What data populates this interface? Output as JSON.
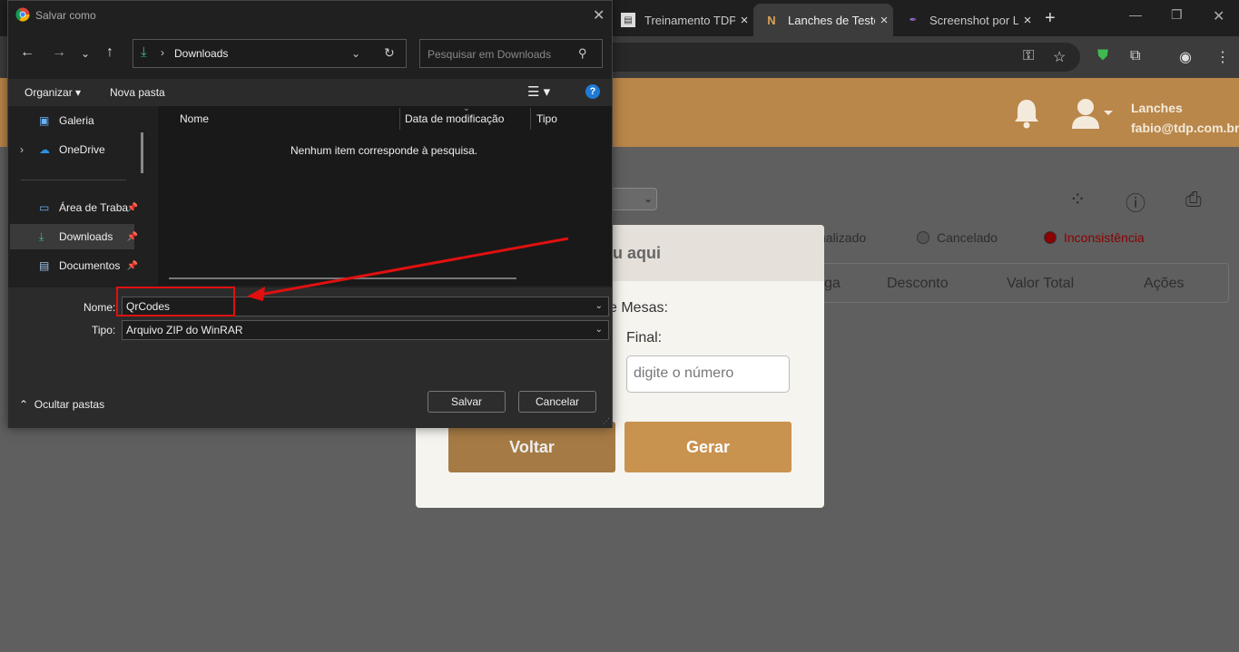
{
  "browser": {
    "tabs": [
      {
        "title": "Treinamento TDP",
        "icon": "doc-icon"
      },
      {
        "title": "Lanches de Teste",
        "icon": "lanches-logo-icon",
        "active": true
      },
      {
        "title": "Screenshot por Lightshot",
        "icon": "feather-icon"
      }
    ]
  },
  "app": {
    "user_name": "Lanches",
    "user_email": "fabio@tdp.com.br",
    "legend": [
      {
        "label": "nalizado",
        "color": "#5a5a5a"
      },
      {
        "label": "Cancelado",
        "color": "#555555"
      },
      {
        "label": "Inconsistência",
        "color": "#8b0000"
      }
    ],
    "table_headers": [
      "ga",
      "Desconto",
      "Valor Total",
      "Ações"
    ],
    "modal": {
      "title": "u aqui",
      "mesas_label": "e Mesas:",
      "final_label": "Final:",
      "final_placeholder": "digite o número",
      "voltar": "Voltar",
      "gerar": "Gerar"
    }
  },
  "dialog": {
    "title": "Salvar como",
    "path": "Downloads",
    "search_placeholder": "Pesquisar em Downloads",
    "organize": "Organizar",
    "new_folder": "Nova pasta",
    "nav_items": [
      {
        "label": "Galeria",
        "icon": "gallery-icon"
      },
      {
        "label": "OneDrive",
        "icon": "cloud-icon"
      },
      {
        "label": "Área de Trabalho",
        "icon": "desktop-icon"
      },
      {
        "label": "Downloads",
        "icon": "download-icon"
      },
      {
        "label": "Documentos",
        "icon": "document-icon"
      }
    ],
    "columns": [
      "Nome",
      "Data de modificação",
      "Tipo"
    ],
    "empty_message": "Nenhum item corresponde à pesquisa.",
    "name_label": "Nome:",
    "name_value": "QrCodes",
    "type_label": "Tipo:",
    "type_value": "Arquivo ZIP do WinRAR",
    "hide_folders": "Ocultar pastas",
    "save": "Salvar",
    "cancel": "Cancelar"
  }
}
